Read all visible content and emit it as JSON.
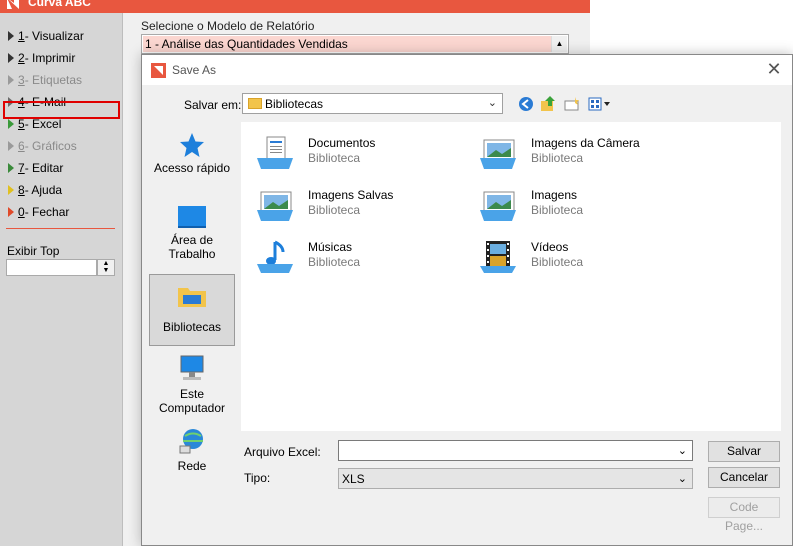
{
  "app": {
    "title": "Curva ABC",
    "brand_color": "#e8573f",
    "menu": [
      {
        "key": "1",
        "label": " - Visualizar",
        "disabled": false
      },
      {
        "key": "2",
        "label": " - Imprimir",
        "disabled": false
      },
      {
        "key": "3",
        "label": " - Etiquetas",
        "disabled": true
      },
      {
        "key": "4",
        "label": " - E-Mail",
        "disabled": false
      },
      {
        "key": "5",
        "label": " - Excel",
        "disabled": false,
        "highlighted": true
      },
      {
        "key": "6",
        "label": " - Gráficos",
        "disabled": true
      },
      {
        "key": "7",
        "label": " - Editar",
        "disabled": false
      },
      {
        "key": "8",
        "label": " - Ajuda",
        "disabled": false
      },
      {
        "key": "0",
        "label": " - Fechar",
        "disabled": false
      }
    ],
    "exibir_top_label": "Exibir Top",
    "report_model_label": "Selecione o Modelo de Relatório",
    "report_selected": "1 - Análise das Quantidades Vendidas"
  },
  "dialog": {
    "title": "Save As",
    "save_in_label": "Salvar em:",
    "save_in_value": "Bibliotecas",
    "places": [
      {
        "label": "Acesso rápido",
        "icon": "star-icon"
      },
      {
        "label": "Área de Trabalho",
        "icon": "desktop-icon"
      },
      {
        "label": "Bibliotecas",
        "icon": "libraries-icon",
        "selected": true
      },
      {
        "label": "Este Computador",
        "icon": "computer-icon"
      },
      {
        "label": "Rede",
        "icon": "network-icon"
      }
    ],
    "files": [
      {
        "name": "Documentos",
        "sub": "Biblioteca",
        "icon": "documents-library-icon"
      },
      {
        "name": "Imagens da Câmera",
        "sub": "Biblioteca",
        "icon": "camera-roll-library-icon"
      },
      {
        "name": "Imagens Salvas",
        "sub": "Biblioteca",
        "icon": "saved-pictures-library-icon"
      },
      {
        "name": "Imagens",
        "sub": "Biblioteca",
        "icon": "pictures-library-icon"
      },
      {
        "name": "Músicas",
        "sub": "Biblioteca",
        "icon": "music-library-icon"
      },
      {
        "name": "Vídeos",
        "sub": "Biblioteca",
        "icon": "videos-library-icon"
      }
    ],
    "filename_label": "Arquivo Excel:",
    "filename_value": "",
    "type_label": "Tipo:",
    "type_value": "XLS",
    "buttons": {
      "save": "Salvar",
      "cancel": "Cancelar",
      "code_page": "Code Page..."
    }
  }
}
